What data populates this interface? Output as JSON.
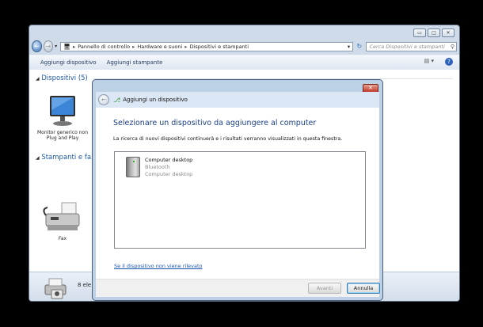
{
  "explorer": {
    "breadcrumb": [
      "Pannello di controllo",
      "Hardware e suoni",
      "Dispositivi e stampanti"
    ],
    "search_placeholder": "Cerca Dispositivi e stampanti",
    "toolbar": {
      "add_device": "Aggiungi dispositivo",
      "add_printer": "Aggiungi stampante"
    },
    "groups": {
      "devices": "Dispositivi (5)",
      "printers": "Stampanti e fax"
    },
    "monitor_label": "Monitor generico non Plug and Play",
    "fax_label": "Fax",
    "status_text": "8 ele"
  },
  "dialog": {
    "title": "Aggiungi un dispositivo",
    "heading": "Selezionare un dispositivo da aggiungere al computer",
    "description": "La ricerca di nuovi dispositivi continuerà e i risultati verranno visualizzati in questa finestra.",
    "devices": [
      {
        "name": "Computer desktop",
        "type": "Bluetooth",
        "category": "Computer desktop"
      }
    ],
    "not_found_link": "Se il dispositivo non viene rilevato",
    "next_button": "Avanti",
    "cancel_button": "Annulla"
  }
}
